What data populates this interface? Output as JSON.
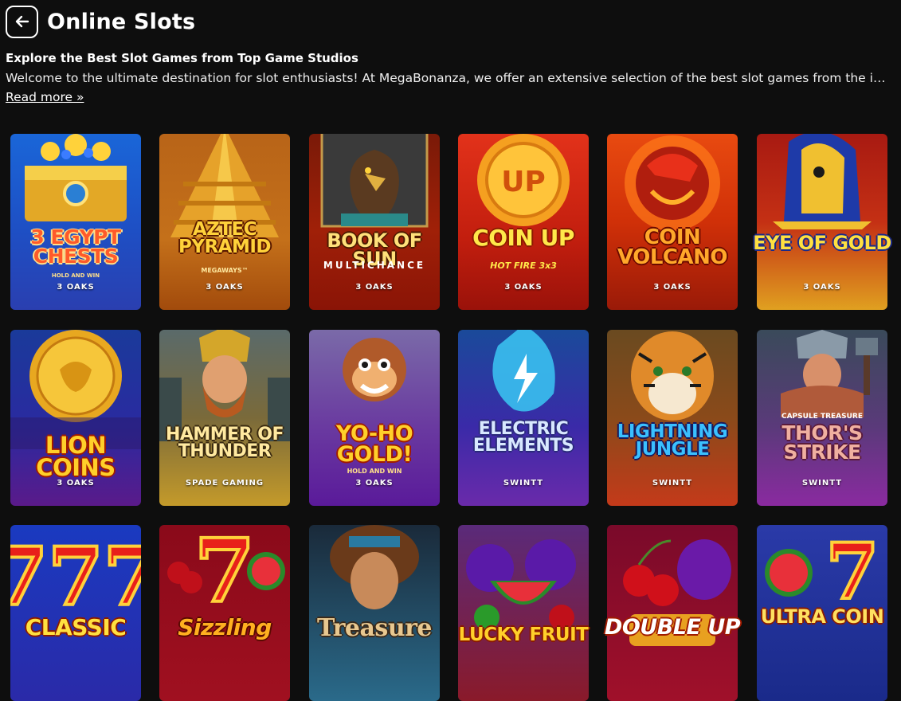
{
  "header": {
    "title": "Online Slots",
    "back_icon": "arrow-left-icon"
  },
  "intro": {
    "heading": "Explore the Best Slot Games from Top Game Studios",
    "text": "Welcome to the ultimate destination for slot enthusiasts! At MegaBonanza, we offer an extensive selection of the best slot games from the industry's leading studios.",
    "read_more": "Read more »"
  },
  "games": [
    {
      "title": "3 EGYPT CHESTS",
      "sub": "HOLD AND WIN",
      "provider": "3 OAKS"
    },
    {
      "title": "AZTEC PYRAMID",
      "sub": "MEGAWAYS™",
      "provider": "3 OAKS"
    },
    {
      "title": "BOOK OF SUN",
      "sub": "MULTICHANCE",
      "provider": "3 OAKS"
    },
    {
      "title": "COIN UP",
      "sub": "HOT FIRE 3x3",
      "provider": "3 OAKS"
    },
    {
      "title": "COIN VOLCANO",
      "sub": "",
      "provider": "3 OAKS"
    },
    {
      "title": "EYE OF GOLD",
      "sub": "",
      "provider": "3 OAKS"
    },
    {
      "title": "LION COINS",
      "sub": "",
      "provider": "3 OAKS"
    },
    {
      "title": "HAMMER OF THUNDER",
      "sub": "",
      "provider": "SPADE GAMING"
    },
    {
      "title": "YO-HO GOLD!",
      "sub": "HOLD AND WIN",
      "provider": "3 OAKS"
    },
    {
      "title": "ELECTRIC ELEMENTS",
      "sub": "",
      "provider": "SWINTT"
    },
    {
      "title": "LIGHTNING JUNGLE",
      "sub": "",
      "provider": "SWINTT"
    },
    {
      "title": "THOR'S STRIKE",
      "sub": "CAPSULE TREASURE",
      "provider": "SWINTT"
    },
    {
      "title": "CLASSIC",
      "sub": "",
      "provider": ""
    },
    {
      "title": "Sizzling",
      "sub": "",
      "provider": ""
    },
    {
      "title": "Treasure",
      "sub": "",
      "provider": ""
    },
    {
      "title": "LUCKY FRUIT",
      "sub": "",
      "provider": ""
    },
    {
      "title": "DOUBLE UP",
      "sub": "",
      "provider": ""
    },
    {
      "title": "ULTRA COIN",
      "sub": "",
      "provider": ""
    }
  ]
}
